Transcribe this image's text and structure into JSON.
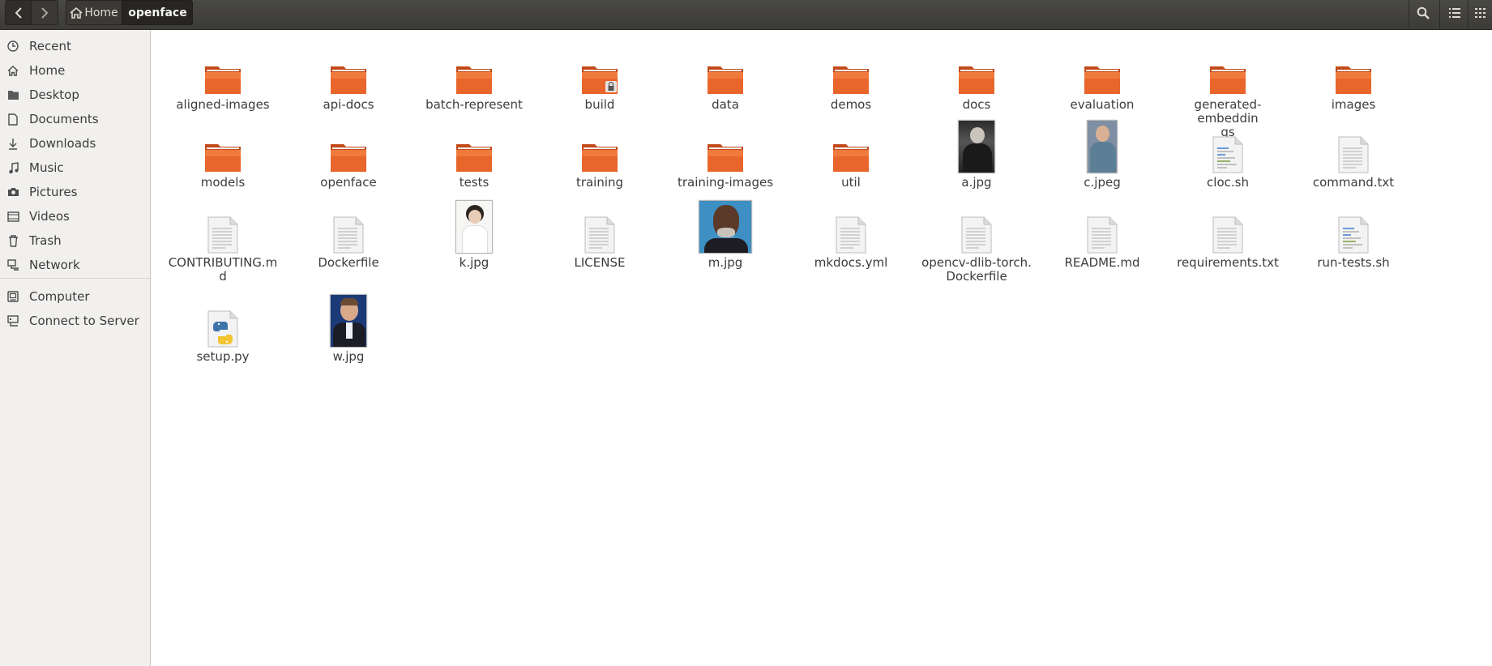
{
  "header": {
    "back_icon": "chevron-left-icon",
    "forward_icon": "chevron-right-icon",
    "breadcrumb_home": "Home",
    "breadcrumb_current": "openface"
  },
  "sidebar": {
    "items": [
      {
        "label": "Recent",
        "icon": "clock-icon"
      },
      {
        "label": "Home",
        "icon": "home-icon"
      },
      {
        "label": "Desktop",
        "icon": "desktop-icon"
      },
      {
        "label": "Documents",
        "icon": "document-icon"
      },
      {
        "label": "Downloads",
        "icon": "download-icon"
      },
      {
        "label": "Music",
        "icon": "music-icon"
      },
      {
        "label": "Pictures",
        "icon": "camera-icon"
      },
      {
        "label": "Videos",
        "icon": "video-icon"
      },
      {
        "label": "Trash",
        "icon": "trash-icon"
      },
      {
        "label": "Network",
        "icon": "network-icon"
      },
      {
        "label": "Computer",
        "icon": "computer-icon"
      },
      {
        "label": "Connect to Server",
        "icon": "server-icon"
      }
    ]
  },
  "files": [
    {
      "name": "aligned-images",
      "type": "folder"
    },
    {
      "name": "api-docs",
      "type": "folder"
    },
    {
      "name": "batch-represent",
      "type": "folder"
    },
    {
      "name": "build",
      "type": "folder-locked"
    },
    {
      "name": "data",
      "type": "folder"
    },
    {
      "name": "demos",
      "type": "folder"
    },
    {
      "name": "docs",
      "type": "folder"
    },
    {
      "name": "evaluation",
      "type": "folder"
    },
    {
      "name": "generated-embeddings",
      "type": "folder"
    },
    {
      "name": "images",
      "type": "folder"
    },
    {
      "name": "models",
      "type": "folder"
    },
    {
      "name": "openface",
      "type": "folder"
    },
    {
      "name": "tests",
      "type": "folder"
    },
    {
      "name": "training",
      "type": "folder"
    },
    {
      "name": "training-images",
      "type": "folder"
    },
    {
      "name": "util",
      "type": "folder"
    },
    {
      "name": "a.jpg",
      "type": "image"
    },
    {
      "name": "c.jpeg",
      "type": "image"
    },
    {
      "name": "cloc.sh",
      "type": "script"
    },
    {
      "name": "command.txt",
      "type": "text"
    },
    {
      "name": "CONTRIBUTING.md",
      "type": "text"
    },
    {
      "name": "Dockerfile",
      "type": "text"
    },
    {
      "name": "k.jpg",
      "type": "image"
    },
    {
      "name": "LICENSE",
      "type": "text"
    },
    {
      "name": "m.jpg",
      "type": "image"
    },
    {
      "name": "mkdocs.yml",
      "type": "text"
    },
    {
      "name": "opencv-dlib-torch.\nDockerfile",
      "type": "text"
    },
    {
      "name": "README.md",
      "type": "text"
    },
    {
      "name": "requirements.txt",
      "type": "text"
    },
    {
      "name": "run-tests.sh",
      "type": "script"
    },
    {
      "name": "setup.py",
      "type": "python"
    },
    {
      "name": "w.jpg",
      "type": "image"
    }
  ],
  "colors": {
    "headerbar": "#3c3b37",
    "sidebar_bg": "#f1f0ee",
    "folder_orange": "#e95420"
  }
}
